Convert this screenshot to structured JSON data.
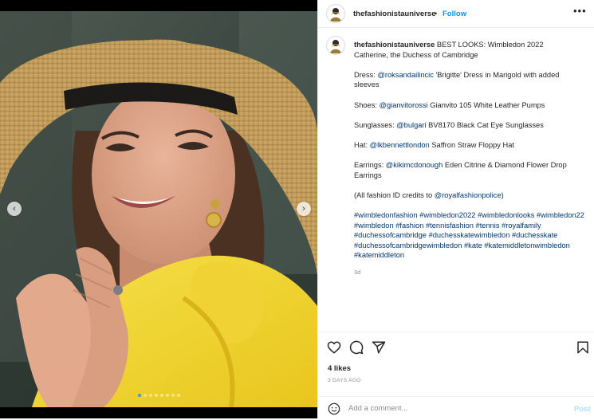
{
  "post": {
    "username": "thefashionistauniverse",
    "separator": "•",
    "follow_label": "Follow",
    "more_label": "•••"
  },
  "caption": {
    "username": "thefashionistauniverse",
    "line1": "BEST LOOKS: Wimbledon 2022",
    "line2": "Catherine, the Duchess of Cambridge",
    "dress_prefix": "Dress: ",
    "dress_mention": "@roksandailincic",
    "dress_text": " 'Brigitte' Dress in Marigold with added sleeves",
    "shoes_prefix": "Shoes: ",
    "shoes_mention": "@gianvitorossi",
    "shoes_text": " Gianvito 105 White Leather Pumps",
    "sunglasses_prefix": "Sunglasses: ",
    "sunglasses_mention": "@bulgari",
    "sunglasses_text": " BV8170 Black Cat Eye Sunglasses",
    "hat_prefix": "Hat: ",
    "hat_mention": "@lkbennettlondon",
    "hat_text": " Saffron Straw Floppy Hat",
    "earrings_prefix": "Earrings: ",
    "earrings_mention": "@kikimcdonough",
    "earrings_text": " Eden Citrine & Diamond Flower Drop Earrings",
    "credits_prefix": "(All fashion ID credits to ",
    "credits_mention": "@royalfashionpolice",
    "credits_suffix": ")",
    "hashtags": [
      "#wimbledonfashion",
      "#wimbledon2022",
      "#wimbledonlooks",
      "#wimbledon22",
      "#wimbledon",
      "#fashion",
      "#tennisfashion",
      "#tennis",
      "#royalfamily",
      "#duchessofcambridge",
      "#duchesskatewimbledon",
      "#duchesskate",
      "#duchessofcambridgewimbledon",
      "#kate",
      "#katemiddletonwimbledon",
      "#katemiddleton"
    ],
    "time": "3d"
  },
  "carousel": {
    "prev_label": "‹",
    "next_label": "›",
    "dot_count": 8,
    "active_dot": 0
  },
  "footer": {
    "likes": "4 likes",
    "posted_ago": "3 DAYS AGO",
    "comment_placeholder": "Add a comment...",
    "post_label": "Post"
  },
  "icons": {
    "like": "heart-icon",
    "comment": "comment-icon",
    "share": "share-icon",
    "save": "bookmark-icon",
    "emoji": "emoji-icon"
  },
  "colors": {
    "link": "#00376b",
    "follow": "#0095f6",
    "post_disabled": "#b2dffc"
  }
}
